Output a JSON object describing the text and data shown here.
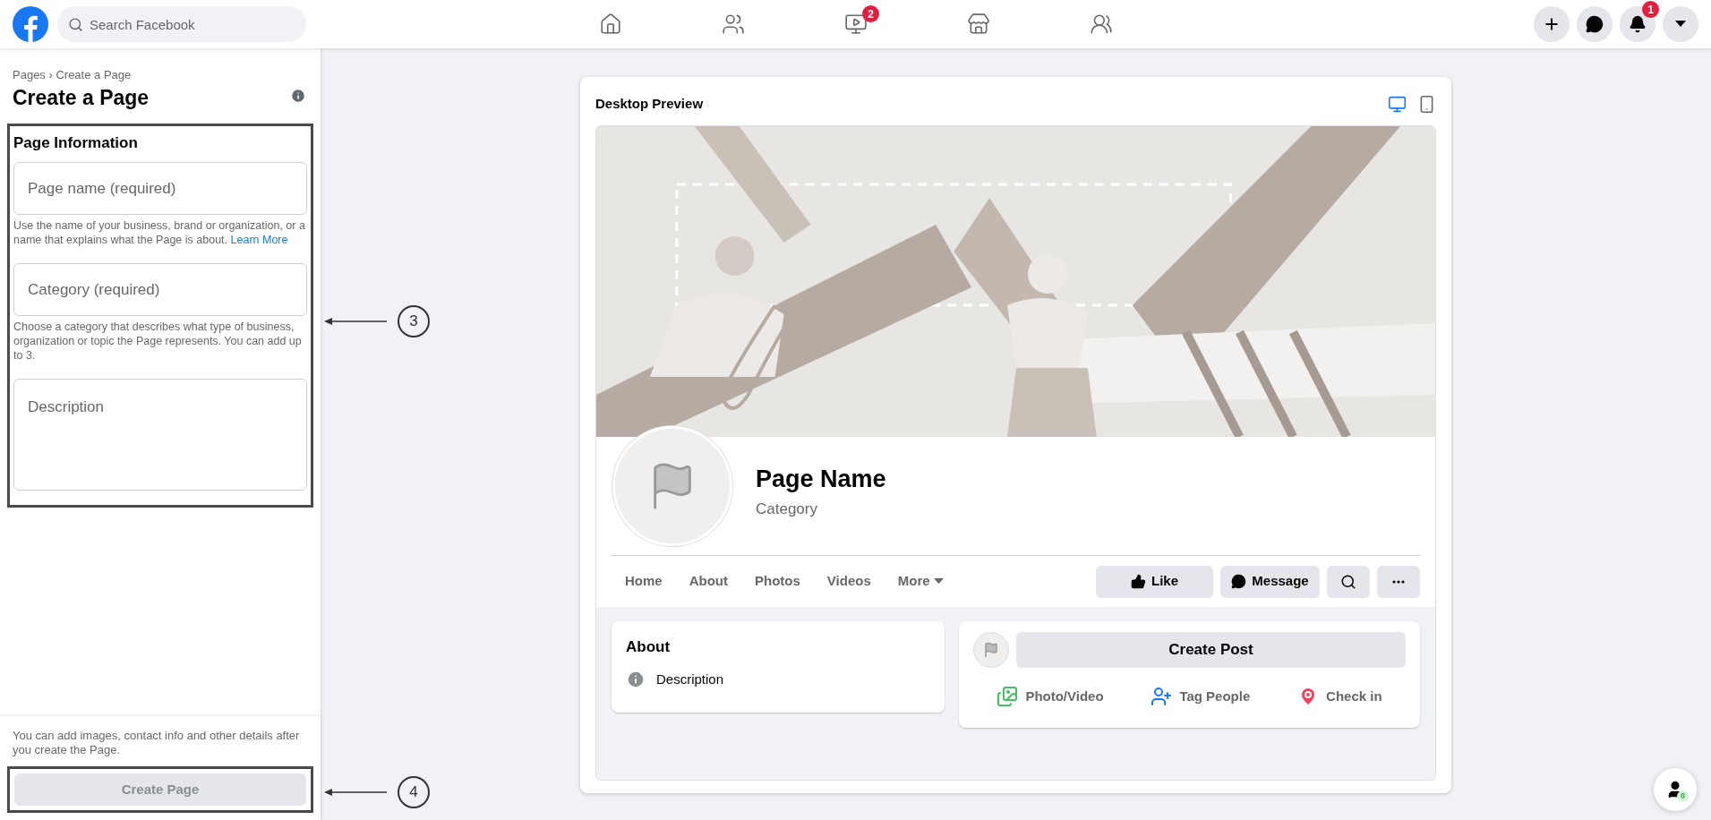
{
  "top_bar": {
    "search": {
      "placeholder": "Search Facebook"
    },
    "nav": [
      {
        "kind": "home"
      },
      {
        "kind": "friends"
      },
      {
        "kind": "watch",
        "badge": "2"
      },
      {
        "kind": "marketplace"
      },
      {
        "kind": "groups"
      }
    ],
    "actions": [
      {
        "kind": "create"
      },
      {
        "kind": "messenger"
      },
      {
        "kind": "notifications",
        "badge": "1"
      },
      {
        "kind": "account"
      }
    ]
  },
  "sidebar": {
    "breadcrumb": "Pages › Create a Page",
    "title": "Create a Page",
    "section": {
      "title": "Page Information",
      "fields": [
        {
          "kind": "input",
          "placeholder": "Page name (required)",
          "helper": "Use the name of your business, brand or organization, or a name that explains what the Page is about.",
          "link": "Learn More"
        },
        {
          "kind": "input",
          "placeholder": "Category (required)",
          "helper": "Choose a category that describes what type of business, organization or topic the Page represents. You can add up to 3."
        },
        {
          "kind": "textarea",
          "placeholder": "Description"
        }
      ]
    },
    "footer_note": "You can add images, contact info and other details after you create the Page.",
    "create_button": {
      "label": "Create Page",
      "disabled": true
    }
  },
  "annotations": [
    {
      "number": "3"
    },
    {
      "number": "4"
    }
  ],
  "preview": {
    "title": "Desktop Preview",
    "views": [
      {
        "kind": "desktop",
        "selected": true
      },
      {
        "kind": "mobile",
        "selected": false
      }
    ],
    "page_name": "Page Name",
    "category": "Category",
    "tabs": [
      {
        "label": "Home"
      },
      {
        "label": "About"
      },
      {
        "label": "Photos"
      },
      {
        "label": "Videos"
      },
      {
        "label": "More",
        "dropdown": true
      }
    ],
    "actions": [
      {
        "kind": "like",
        "label": "Like"
      },
      {
        "kind": "message",
        "label": "Message"
      },
      {
        "kind": "search"
      },
      {
        "kind": "more"
      }
    ],
    "about": {
      "title": "About",
      "items": [
        "Description"
      ]
    },
    "composer": {
      "button": "Create Post",
      "options": [
        {
          "kind": "photo",
          "label": "Photo/Video"
        },
        {
          "kind": "tag",
          "label": "Tag People"
        },
        {
          "kind": "checkin",
          "label": "Check in"
        }
      ]
    }
  },
  "contacts_button": {
    "count": "0"
  }
}
